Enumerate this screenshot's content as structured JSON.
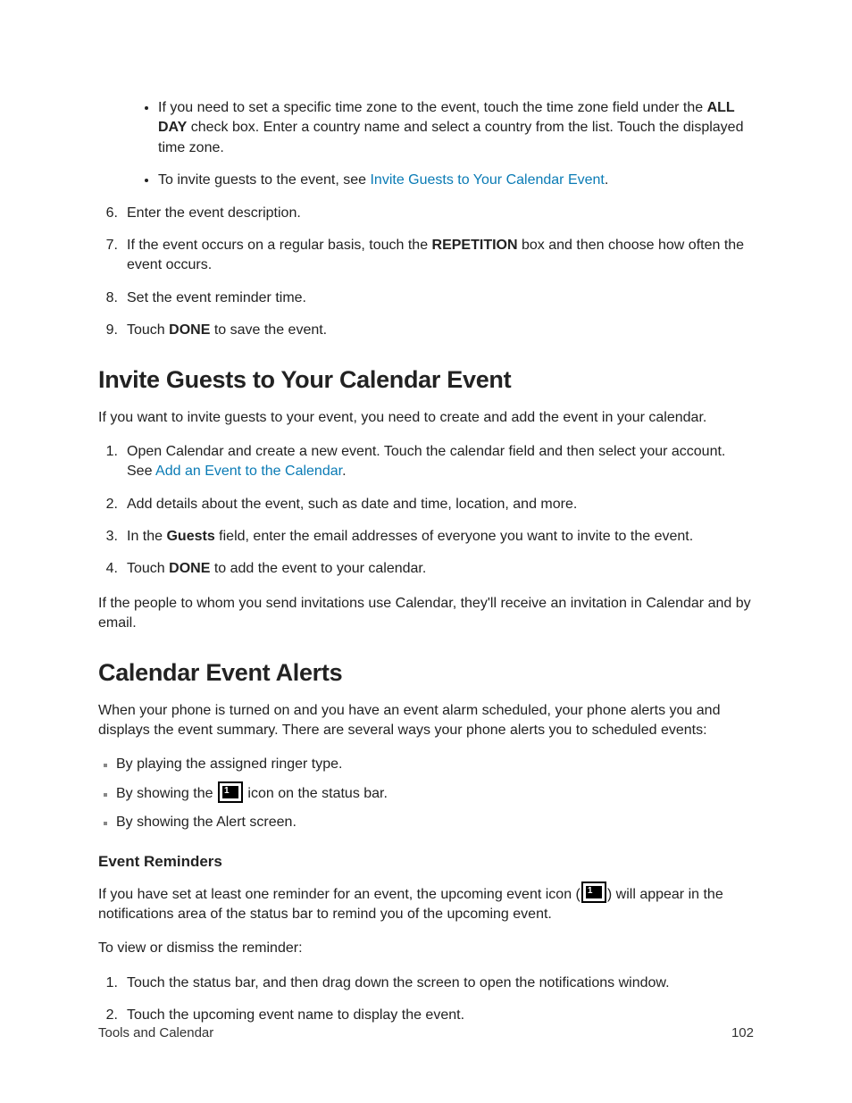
{
  "top_bullets": {
    "b1_pre": "If you need to set a specific time zone to the event, touch the time zone field under the ",
    "b1_bold": "ALL DAY",
    "b1_post": " check box. Enter a country name and select a country from the list. Touch the displayed time zone.",
    "b2_pre": "To invite guests to the event, see ",
    "b2_link": "Invite Guests to Your Calendar Event",
    "b2_post": "."
  },
  "ol_top": {
    "i6": "Enter the event description.",
    "i7_pre": "If the event occurs on a regular basis, touch the ",
    "i7_bold": "REPETITION",
    "i7_post": " box and then choose how often the event occurs.",
    "i8": "Set the event reminder time.",
    "i9_pre": "Touch ",
    "i9_bold": "DONE",
    "i9_post": " to save the event."
  },
  "h_invite": "Invite Guests to Your Calendar Event",
  "p_invite": "If you want to invite guests to your event, you need to create and add the event in your calendar.",
  "ol_invite": {
    "i1_pre": "Open Calendar and create a new event. Touch the calendar field and then select your account. See ",
    "i1_link": "Add an Event to the Calendar",
    "i1_post": ".",
    "i2": "Add details about the event, such as date and time, location, and more.",
    "i3_pre": "In the ",
    "i3_bold": "Guests",
    "i3_post": " field, enter the email addresses of everyone you want to invite to the event.",
    "i4_pre": "Touch ",
    "i4_bold": "DONE",
    "i4_post": " to add the event to your calendar."
  },
  "p_invite_after": "If the people to whom you send invitations use Calendar, they'll receive an invitation in Calendar and by email.",
  "h_alerts": "Calendar Event Alerts",
  "p_alerts": "When your phone is turned on and you have an event alarm scheduled, your phone alerts you and displays the event summary. There are several ways your phone alerts you to scheduled events:",
  "ul_alerts": {
    "a1": "By playing the assigned ringer type.",
    "a2_pre": "By showing the ",
    "a2_post": " icon on the status bar.",
    "a3": "By showing the Alert screen."
  },
  "h_reminders": "Event Reminders",
  "p_reminders_pre": "If you have set at least one reminder for an event, the upcoming event icon (",
  "p_reminders_post": ") will appear in the notifications area of the status bar to remind you of the upcoming event.",
  "p_view": "To view or dismiss the reminder:",
  "ol_view": {
    "v1": "Touch the status bar, and then drag down the screen to open the notifications window.",
    "v2": "Touch the upcoming event name to display the event."
  },
  "footer_left": "Tools and Calendar",
  "footer_right": "102",
  "icon_label": "1"
}
